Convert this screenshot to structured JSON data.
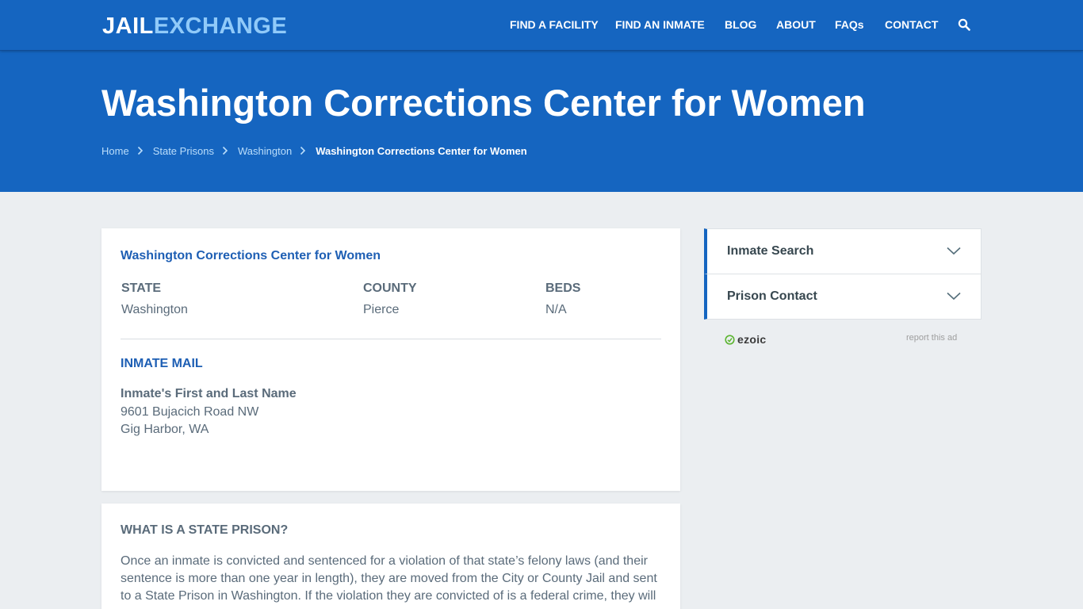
{
  "brand": {
    "part1": "JAIL",
    "part2": "EXCHANGE"
  },
  "nav": {
    "items": [
      {
        "label": "FIND A FACILITY"
      },
      {
        "label": "FIND AN INMATE"
      },
      {
        "label": "BLOG"
      },
      {
        "label": "ABOUT"
      },
      {
        "label": "FAQs"
      },
      {
        "label": "CONTACT"
      }
    ],
    "search_icon": "search-icon"
  },
  "hero": {
    "title": "Washington Corrections Center for Women",
    "breadcrumb": [
      {
        "label": "Home"
      },
      {
        "label": "State Prisons"
      },
      {
        "label": "Washington"
      },
      {
        "label": "Washington Corrections Center for Women"
      }
    ]
  },
  "facility": {
    "name": "Washington Corrections Center for Women",
    "stats": [
      {
        "label": "STATE",
        "value": "Washington"
      },
      {
        "label": "COUNTY",
        "value": "Pierce"
      },
      {
        "label": "BEDS",
        "value": "N/A"
      }
    ],
    "mail": {
      "heading": "INMATE MAIL",
      "name_line": "Inmate's First and Last Name",
      "street": "9601 Bujacich Road NW",
      "city": "Gig Harbor, WA"
    }
  },
  "info": {
    "heading": "WHAT IS A STATE PRISON?",
    "text": "Once an inmate is convicted and sentenced for a violation of that state’s felony laws (and their sentence is more than one year in length), they are moved from the City or County Jail and sent to a State Prison in Washington. If the violation they are convicted of is a federal crime, they will"
  },
  "sidebar": {
    "accordion": [
      {
        "label": "Inmate Search"
      },
      {
        "label": "Prison Contact"
      }
    ],
    "ad": {
      "brand": "ezoic",
      "report": "report this ad"
    }
  },
  "colors": {
    "primary": "#1565c0",
    "heading_blue": "#1e5fb4",
    "logo_accent": "#90caf9"
  }
}
